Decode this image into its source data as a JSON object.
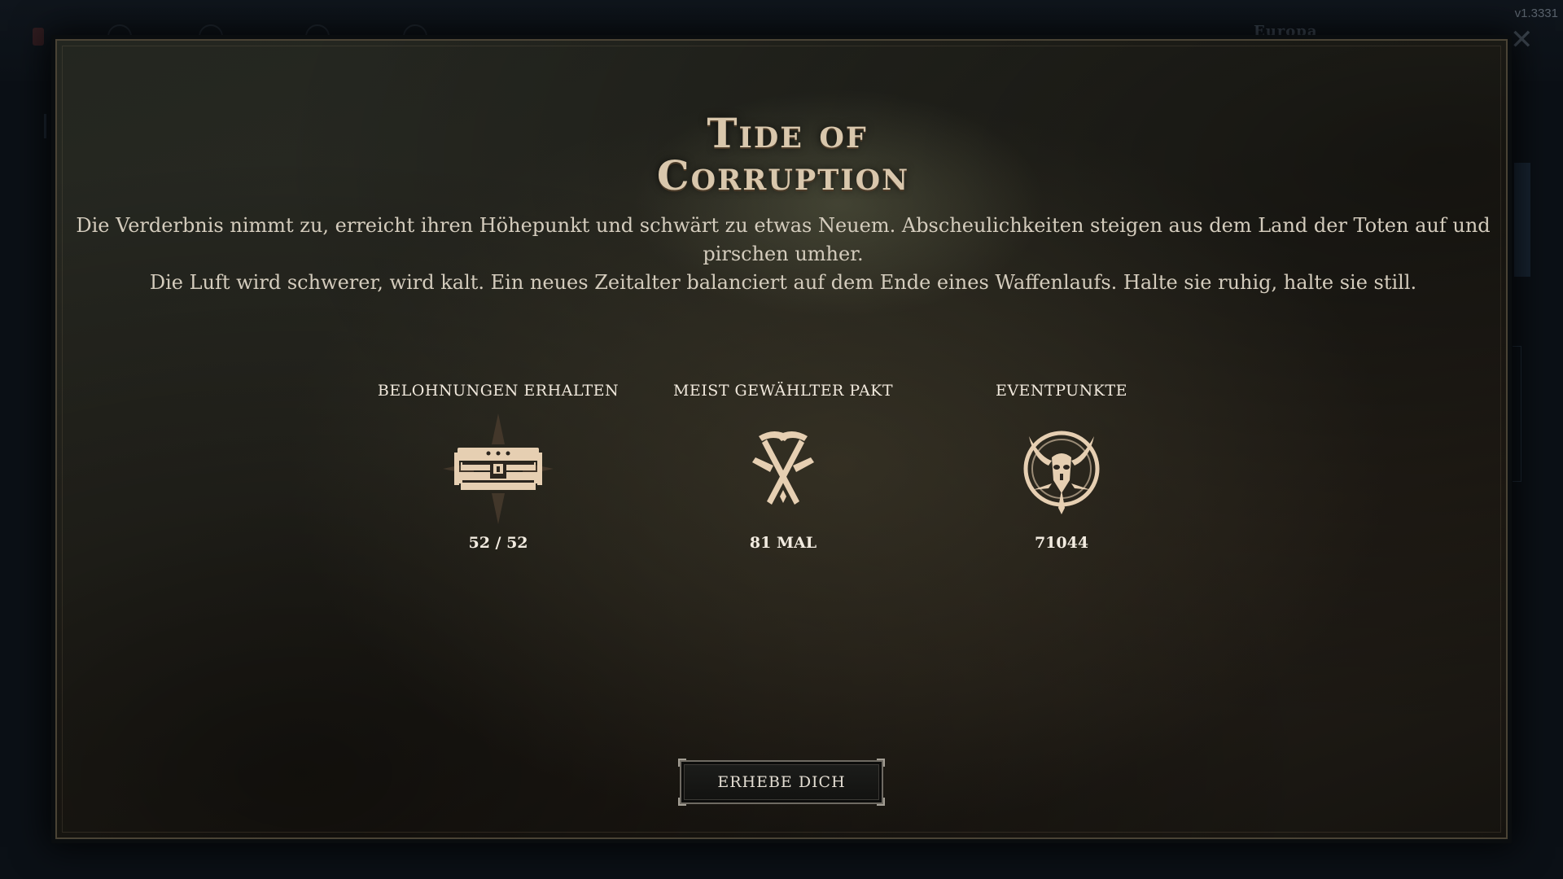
{
  "background": {
    "region_label": "Europa",
    "version": "v1.3331"
  },
  "modal": {
    "title_line1": "Tide of",
    "title_line2": "Corruption",
    "description": [
      "Die Verderbnis nimmt zu, erreicht ihren Höhepunkt und schwärt zu etwas Neuem. Abscheulichkeiten steigen aus dem Land der Toten auf und pirschen umher.",
      "Die Luft wird schwerer, wird kalt. Ein neues Zeitalter balanciert auf dem Ende eines Waffenlaufs. Halte sie ruhig, halte sie still."
    ],
    "stats": [
      {
        "label": "BELOHNUNGEN ERHALTEN",
        "value": "52 / 52",
        "icon": "treasure-chest-icon"
      },
      {
        "label": "MEIST GEWÄHLTER PAKT",
        "value": "81 MAL",
        "icon": "crossed-picks-icon"
      },
      {
        "label": "EVENTPUNKTE",
        "value": "71044",
        "icon": "demon-skull-icon"
      }
    ],
    "button_label": "ERHEBE DICH"
  },
  "colors": {
    "title": "#d9c7ac",
    "icon": "#e6cfb2",
    "text": "#d4ccbd"
  }
}
